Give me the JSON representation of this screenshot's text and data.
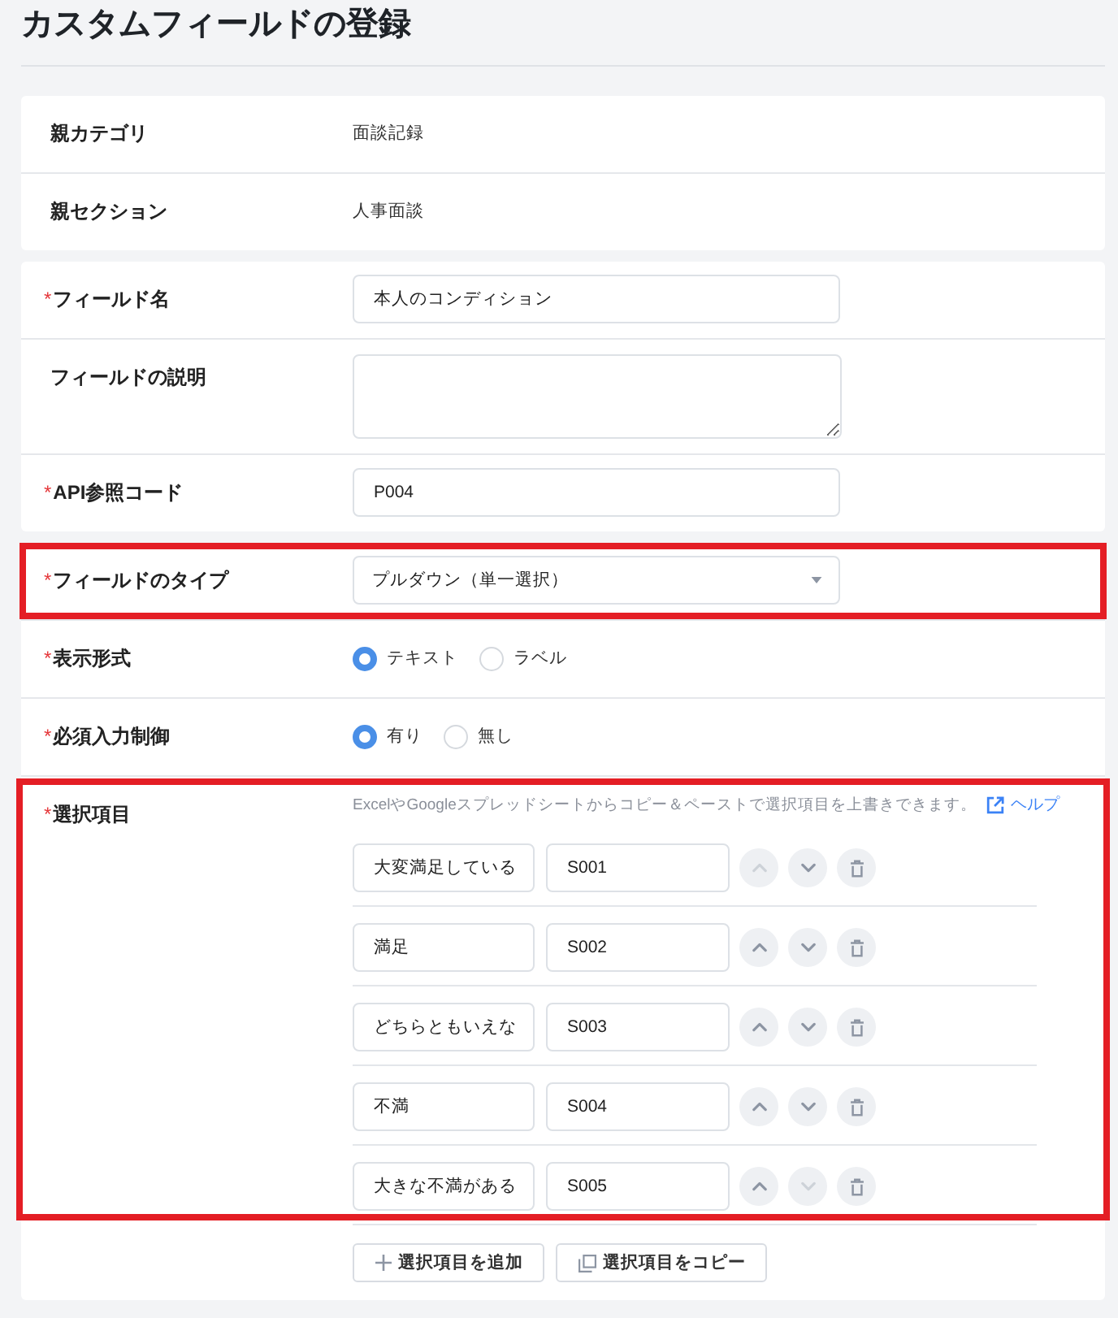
{
  "title": "カスタムフィールドの登録",
  "cards": [
    {
      "rows": [
        {
          "kind": "info",
          "label": "親カテゴリ",
          "value": "面談記録"
        },
        {
          "kind": "info",
          "label": "親セクション",
          "value": "人事面談"
        }
      ]
    },
    {
      "rows": [
        {
          "kind": "text",
          "required_mark": "*",
          "label": "フィールド名",
          "value": "本人のコンディション"
        },
        {
          "kind": "textarea",
          "label": "フィールドの説明"
        },
        {
          "kind": "text",
          "required_mark": "*",
          "label": "API参照コード",
          "value": "P004"
        }
      ]
    },
    {
      "rows": [
        {
          "kind": "select",
          "required_mark": "*",
          "label": "フィールドのタイプ",
          "value": "プルダウン（単一選択）",
          "highlighted": true
        },
        {
          "kind": "radio",
          "required_mark": "*",
          "label": "表示形式",
          "highlighted": false,
          "options": [
            {
              "label": "テキスト",
              "selected": true
            },
            {
              "label": "ラベル",
              "selected": false
            }
          ]
        },
        {
          "kind": "radio",
          "required_mark": "*",
          "label": "必須入力制御",
          "highlighted": false,
          "options": [
            {
              "label": "有り",
              "selected": true
            },
            {
              "label": "無し",
              "selected": false
            }
          ]
        },
        {
          "kind": "choices",
          "required_mark": "*",
          "label": "選択項目",
          "highlighted": true,
          "hint": "ExcelやGoogleスプレッドシートからコピー＆ペーストで選択項目を上書きできます。",
          "help_link": "ヘルプ",
          "items": [
            {
              "label": "大変満足している",
              "code": "S001",
              "up_disabled": true,
              "down_disabled": false
            },
            {
              "label": "満足",
              "code": "S002",
              "up_disabled": false,
              "down_disabled": false
            },
            {
              "label": "どちらともいえな",
              "code": "S003",
              "up_disabled": false,
              "down_disabled": false
            },
            {
              "label": "不満",
              "code": "S004",
              "up_disabled": false,
              "down_disabled": false
            },
            {
              "label": "大きな不満がある",
              "code": "S005",
              "up_disabled": false,
              "down_disabled": true
            }
          ]
        },
        {
          "kind": "actions",
          "buttons": [
            {
              "kind": "add",
              "label": "選択項目を追加"
            },
            {
              "kind": "copy",
              "label": "選択項目をコピー"
            }
          ]
        }
      ]
    }
  ]
}
